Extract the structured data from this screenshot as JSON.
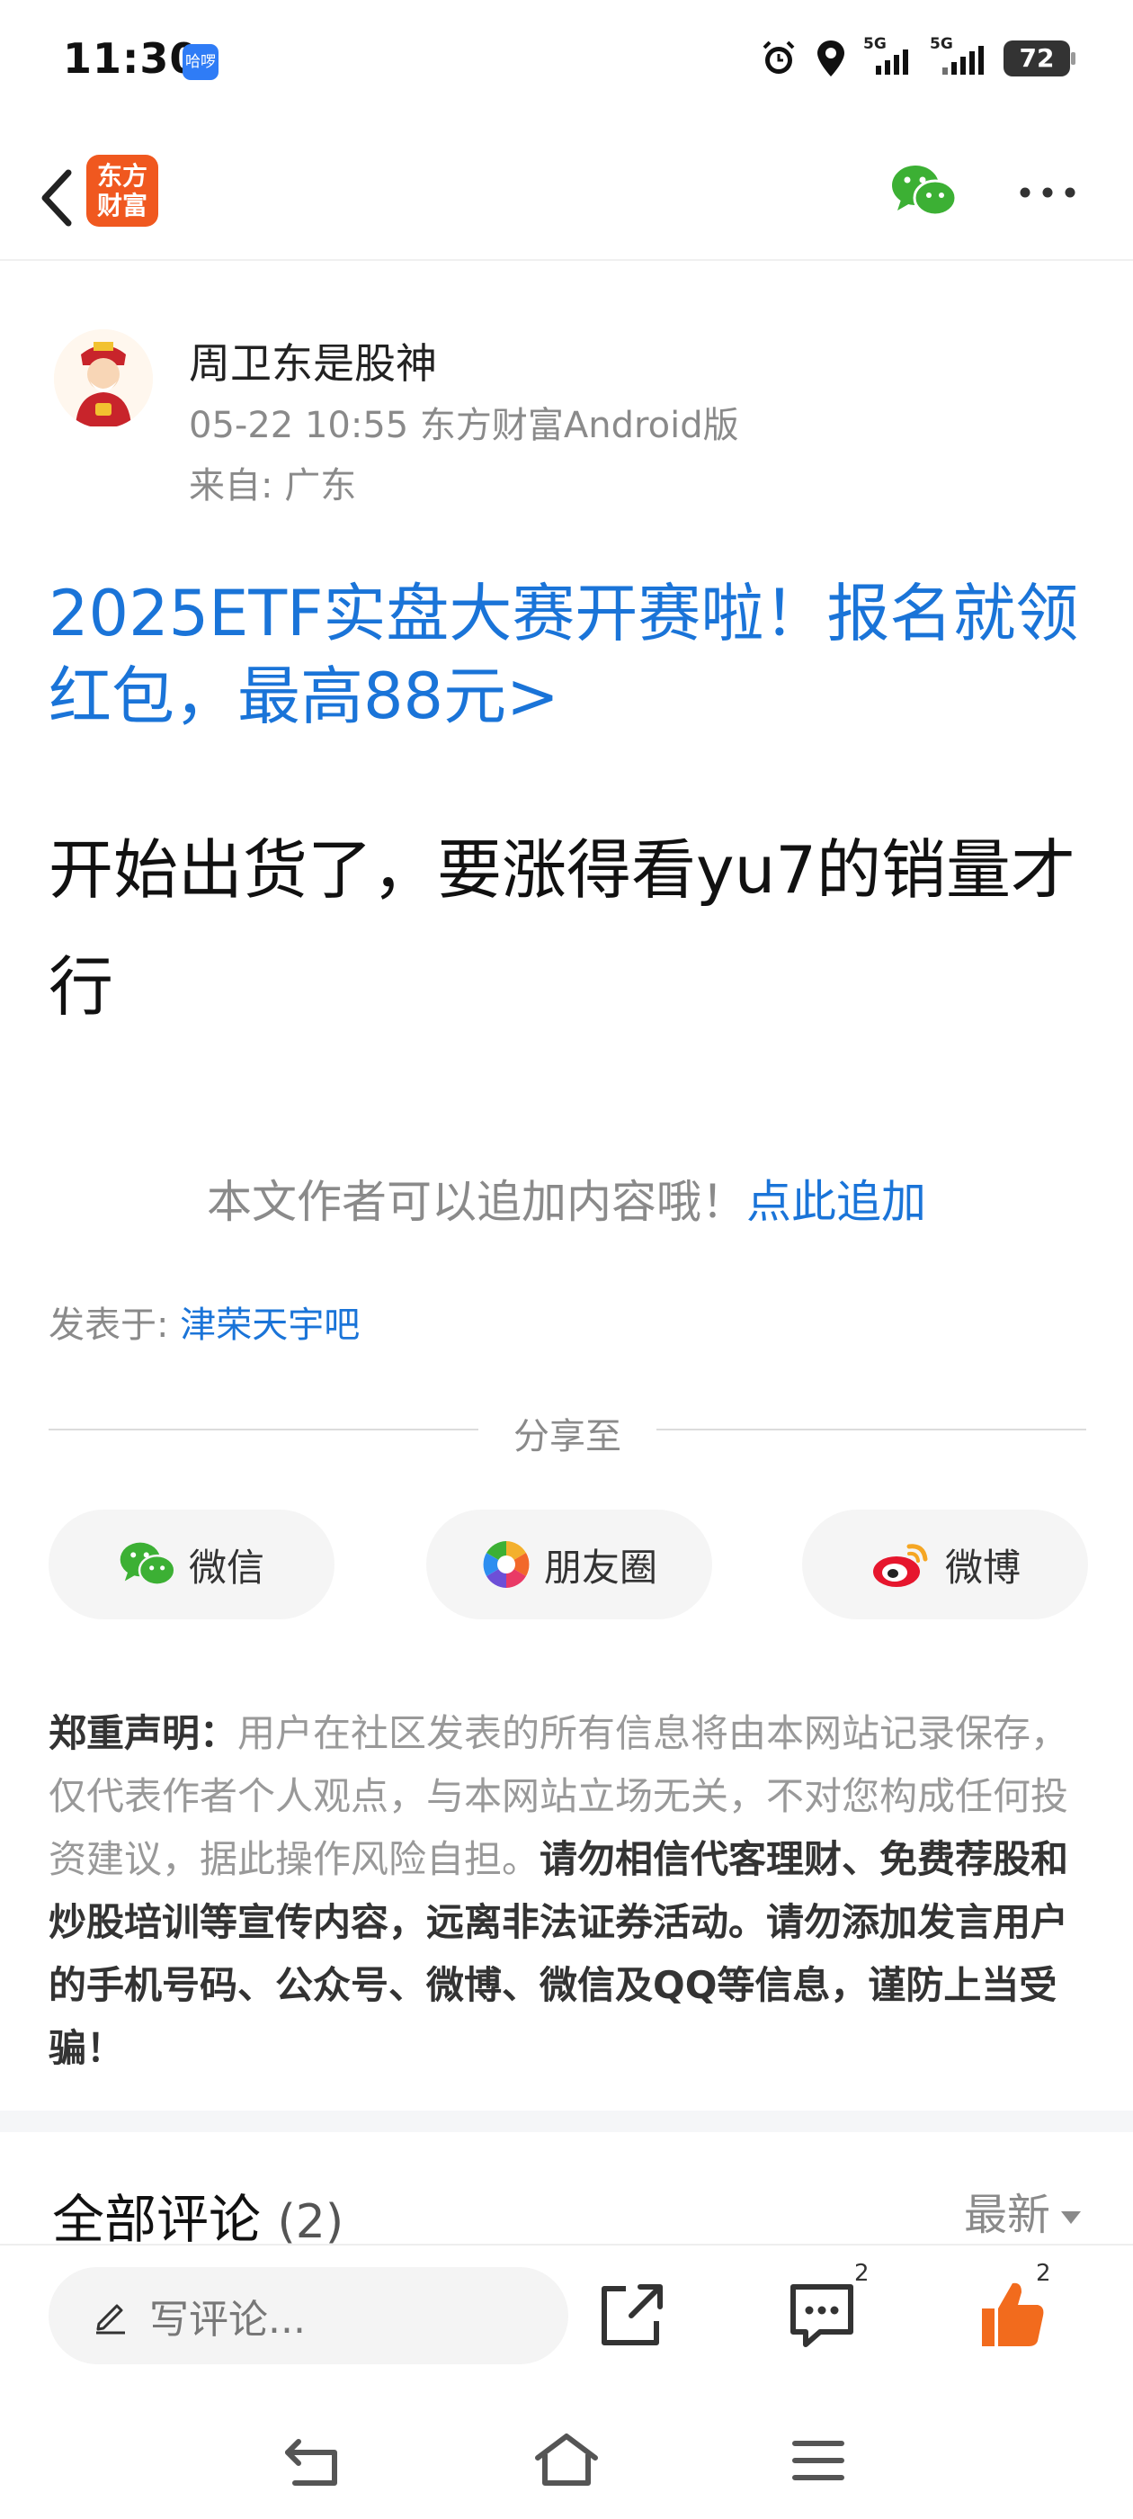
{
  "status_bar": {
    "time": "11:30",
    "app_badge": "哈啰",
    "signal1_label": "5G",
    "signal2_label": "5G",
    "battery": "72"
  },
  "nav": {
    "brand_logo_line1": "东方",
    "brand_logo_line2": "财富"
  },
  "post": {
    "author": "周卫东是股神",
    "meta": "05-22 10:55 东方财富Android版",
    "from": "来自: 广东",
    "promo_link": "2025ETF实盘大赛开赛啦！报名就领红包，最高88元>",
    "body": "开始出货了，要涨得看yu7的销量才行",
    "add_content_text": "本文作者可以追加内容哦！",
    "add_content_link": "点此追加",
    "posted_in_label": "发表于: ",
    "posted_in_forum": "津荣天宇吧"
  },
  "share": {
    "title": "分享至",
    "buttons": [
      {
        "label": "微信",
        "icon": "wechat-icon"
      },
      {
        "label": "朋友圈",
        "icon": "moments-icon"
      },
      {
        "label": "微博",
        "icon": "weibo-icon"
      }
    ]
  },
  "disclaimer": {
    "heading": "郑重声明：",
    "part1": "用户在社区发表的所有信息将由本网站记录保存，仅代表作者个人观点，与本网站立场无关，不对您构成任何投资建议，据此操作风险自担。",
    "part2": "请勿相信代客理财、免费荐股和炒股培训等宣传内容，远离非法证券活动。请勿添加发言用户的手机号码、公众号、微博、微信及QQ等信息，谨防上当受骗！"
  },
  "comments": {
    "title": "全部评论",
    "count": "(2)",
    "sort": "最新"
  },
  "bottom_bar": {
    "comment_placeholder": "写评论...",
    "comment_count": "2",
    "like_count": "2"
  },
  "colors": {
    "link_blue": "#1a74d8",
    "brand_orange": "#f0581f",
    "like_orange": "#f26b1d",
    "wechat_green": "#3cb034"
  }
}
